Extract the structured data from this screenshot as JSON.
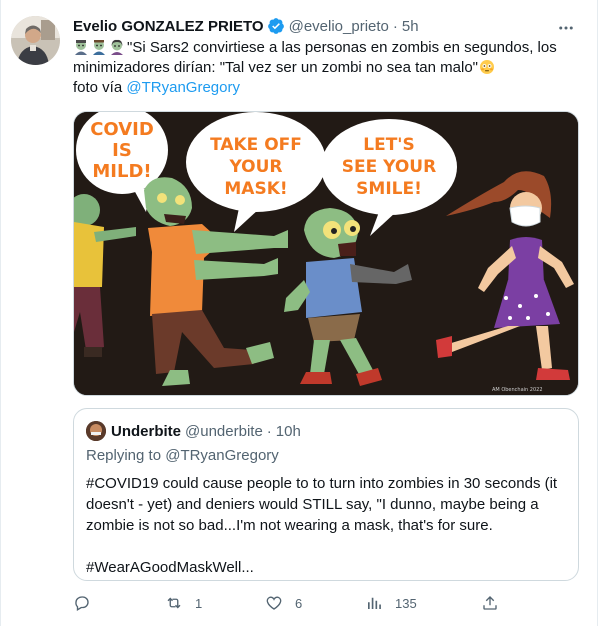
{
  "author": {
    "name": "Evelio GONZALEZ PRIETO",
    "handle": "@evelio_prieto",
    "separator": "·",
    "time": "5h"
  },
  "tweet": {
    "line1": "\"Si Sars2 convirtiese a las personas en zombis en segundos, los",
    "line2": "minimizadores dirían: \"Tal vez ser un zombi no sea tan malo\"",
    "line3_prefix": "foto vía ",
    "mention": "@TRyanGregory"
  },
  "media": {
    "bubble1": [
      "COVID",
      "IS",
      "MILD!"
    ],
    "bubble2": [
      "TAKE OFF",
      "YOUR",
      "MASK!"
    ],
    "bubble3": [
      "LET'S",
      "SEE YOUR",
      "SMILE!"
    ],
    "credit": "AM Obenchain 2022"
  },
  "quote": {
    "name": "Underbite",
    "handle": "@underbite",
    "separator": "·",
    "time": "10h",
    "replying": "Replying to @TRyanGregory",
    "line1": "#COVID19 could cause people to to turn into zombies in 30 seconds (it",
    "line2": "doesn't - yet) and deniers would STILL say, \"I dunno, maybe being a",
    "line3": "zombie is not so bad...I'm not wearing a mask, that's for sure.",
    "line4": "#WearAGoodMaskWell..."
  },
  "actions": {
    "reply_count": "",
    "retweet_count": "1",
    "like_count": "6",
    "views_count": "135"
  },
  "colors": {
    "accent": "#1d9bf0",
    "secondary_text": "#536471",
    "border": "#cfd9de",
    "bubble_text": "#f47b20"
  }
}
